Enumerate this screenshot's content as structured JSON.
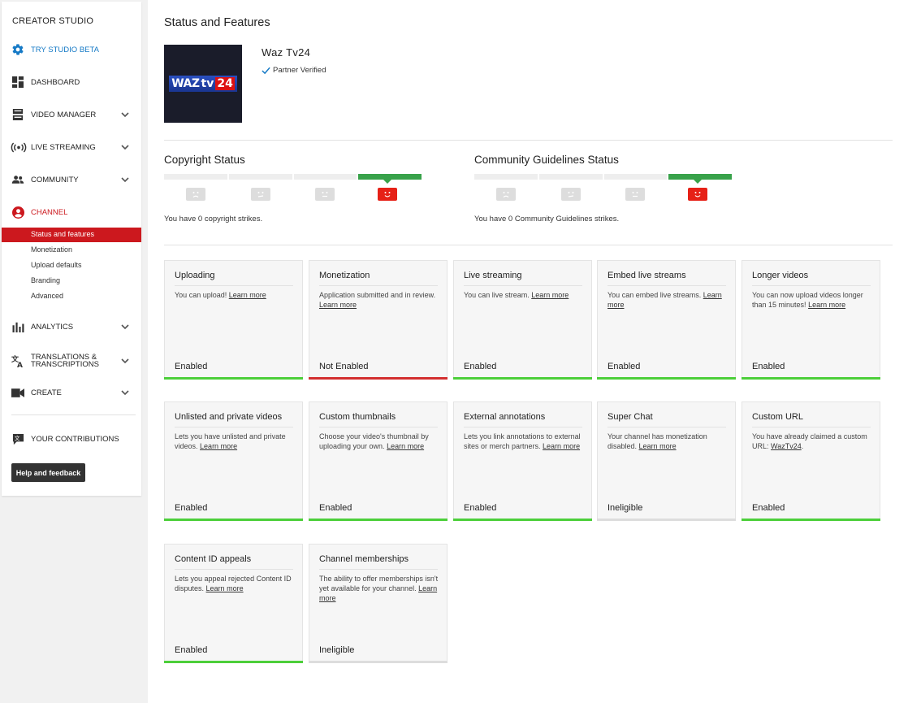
{
  "sidebar": {
    "title": "CREATOR STUDIO",
    "items": [
      {
        "label": "TRY STUDIO BETA",
        "icon": "gear-icon"
      },
      {
        "label": "DASHBOARD",
        "icon": "dashboard-icon"
      },
      {
        "label": "VIDEO MANAGER",
        "icon": "video-manager-icon"
      },
      {
        "label": "LIVE STREAMING",
        "icon": "live-streaming-icon"
      },
      {
        "label": "COMMUNITY",
        "icon": "community-icon"
      },
      {
        "label": "CHANNEL",
        "icon": "account-icon"
      },
      {
        "label": "ANALYTICS",
        "icon": "analytics-icon"
      },
      {
        "label": "TRANSLATIONS &",
        "label2": "TRANSCRIPTIONS",
        "icon": "translate-icon"
      },
      {
        "label": "CREATE",
        "icon": "create-icon"
      },
      {
        "label": "YOUR CONTRIBUTIONS",
        "icon": "contributions-icon"
      }
    ],
    "channel_sub": [
      "Status and features",
      "Monetization",
      "Upload defaults",
      "Branding",
      "Advanced"
    ],
    "help_button": "Help and feedback"
  },
  "page_title": "Status and Features",
  "channel": {
    "name": "Waz Tv24",
    "verified_label": "Partner Verified",
    "logo_text": [
      "WAZ",
      "tv",
      "24"
    ]
  },
  "copyright": {
    "title": "Copyright Status",
    "text": "You have 0 copyright strikes."
  },
  "community": {
    "title": "Community Guidelines Status",
    "text": "You have 0 Community Guidelines strikes."
  },
  "colors": {
    "good": "#38a24a",
    "accent_red": "#cc181e",
    "link_blue": "#167ac6"
  },
  "learn_more": "Learn more",
  "cards": [
    {
      "title": "Uploading",
      "desc": "You can upload!",
      "link": "Learn more",
      "status": "Enabled",
      "state": "green"
    },
    {
      "title": "Monetization",
      "desc": "Application submitted and in review.",
      "link": "Learn more",
      "status": "Not Enabled",
      "state": "red"
    },
    {
      "title": "Live streaming",
      "desc": "You can live stream.",
      "link": "Learn more",
      "status": "Enabled",
      "state": "green"
    },
    {
      "title": "Embed live streams",
      "desc": "You can embed live streams.",
      "link": "Learn more",
      "status": "Enabled",
      "state": "green"
    },
    {
      "title": "Longer videos",
      "desc": "You can now upload videos longer than 15 minutes!",
      "link": "Learn more",
      "status": "Enabled",
      "state": "green"
    },
    {
      "title": "Unlisted and private videos",
      "desc": "Lets you have unlisted and private videos.",
      "link": "Learn more",
      "status": "Enabled",
      "state": "green"
    },
    {
      "title": "Custom thumbnails",
      "desc": "Choose your video's thumbnail by uploading your own.",
      "link": "Learn more",
      "status": "Enabled",
      "state": "green"
    },
    {
      "title": "External annotations",
      "desc": "Lets you link annotations to external sites or merch partners.",
      "link": "Learn more",
      "status": "Enabled",
      "state": "green"
    },
    {
      "title": "Super Chat",
      "desc": "Your channel has monetization disabled.",
      "link": "Learn more",
      "status": "Ineligible",
      "state": "gray"
    },
    {
      "title": "Custom URL",
      "desc": "You have already claimed a custom URL:",
      "link": "WazTv24",
      "suffix": ".",
      "status": "Enabled",
      "state": "green"
    },
    {
      "title": "Content ID appeals",
      "desc": "Lets you appeal rejected Content ID disputes.",
      "link": "Learn more",
      "status": "Enabled",
      "state": "green"
    },
    {
      "title": "Channel memberships",
      "desc": "The ability to offer memberships isn't yet available for your channel.",
      "link": "Learn more",
      "status": "Ineligible",
      "state": "gray"
    }
  ]
}
